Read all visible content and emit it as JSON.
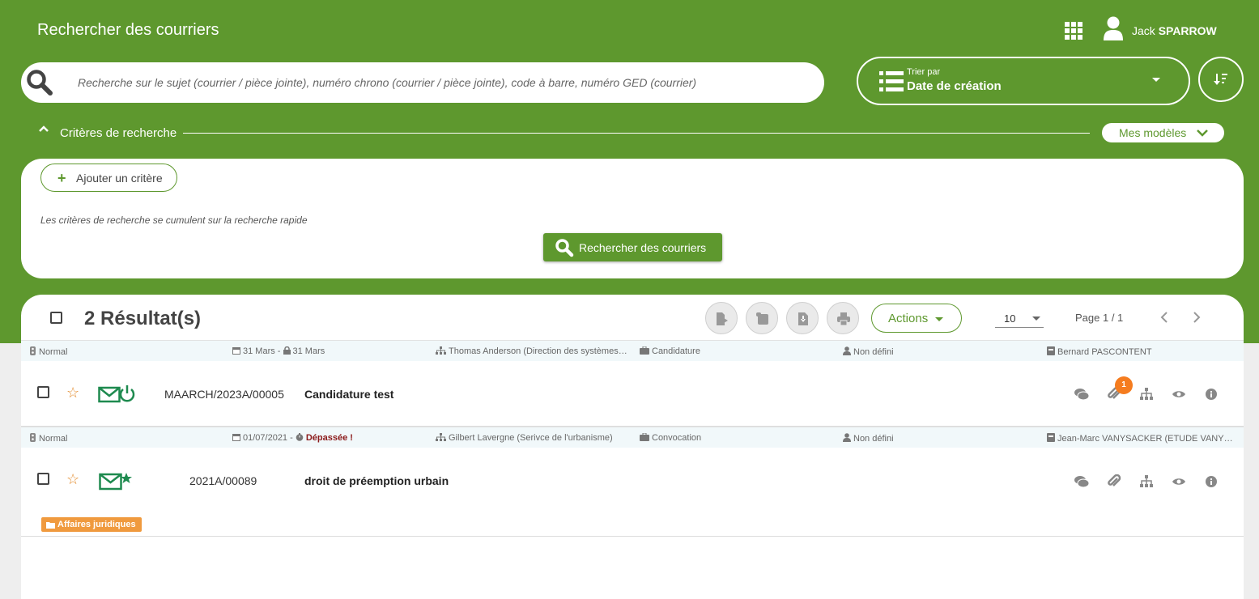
{
  "colors": {
    "brand": "#5e982e",
    "badge": "#f57c1f",
    "tag": "#f09a3e",
    "star": "#e38b2c",
    "mail_icon": "#1e8a4f",
    "overdue": "#8b1a1a"
  },
  "header": {
    "title": "Rechercher des courriers",
    "apps_icon": "apps-grid-icon",
    "user": {
      "first_name": "Jack",
      "last_name": "SPARROW"
    }
  },
  "search": {
    "placeholder": "Recherche sur le sujet (courrier / pièce jointe), numéro chrono (courrier / pièce jointe), code à barre, numéro GED (courrier)",
    "value": ""
  },
  "sort": {
    "label": "Trier par",
    "value": "Date de création"
  },
  "criteria": {
    "title": "Critères de recherche",
    "models_label": "Mes modèles",
    "add_label": "Ajouter un critère",
    "hint": "Les critères de recherche se cumulent sur la recherche rapide",
    "search_button": "Rechercher des courriers"
  },
  "results": {
    "count_label": "2 Résultat(s)",
    "actions_label": "Actions",
    "page_size": "10",
    "page_info": "Page 1 / 1",
    "items": [
      {
        "priority": "Normal",
        "dates": "31 Mars - ",
        "limit": "31 Mars",
        "limit_overdue": false,
        "assignee": "Thomas Anderson (Direction des systèmes d'information)",
        "doctype": "Candidature",
        "contact": "Non défini",
        "sender": "Bernard PASCONTENT",
        "chrono": "MAARCH/2023A/00005",
        "subject": "Candidature test",
        "attachments_count": "1",
        "tag": ""
      },
      {
        "priority": "Normal",
        "dates": "01/07/2021 - ",
        "limit": "Dépassée !",
        "limit_overdue": true,
        "assignee": "Gilbert Lavergne (Serivce de l'urbanisme)",
        "doctype": "Convocation",
        "contact": "Non défini",
        "sender": "Jean-Marc VANYSACKER (ETUDE VANYSACKER)",
        "chrono": "2021A/00089",
        "subject": "droit de préemption urbain",
        "attachments_count": "",
        "tag": "Affaires juridiques"
      }
    ]
  }
}
